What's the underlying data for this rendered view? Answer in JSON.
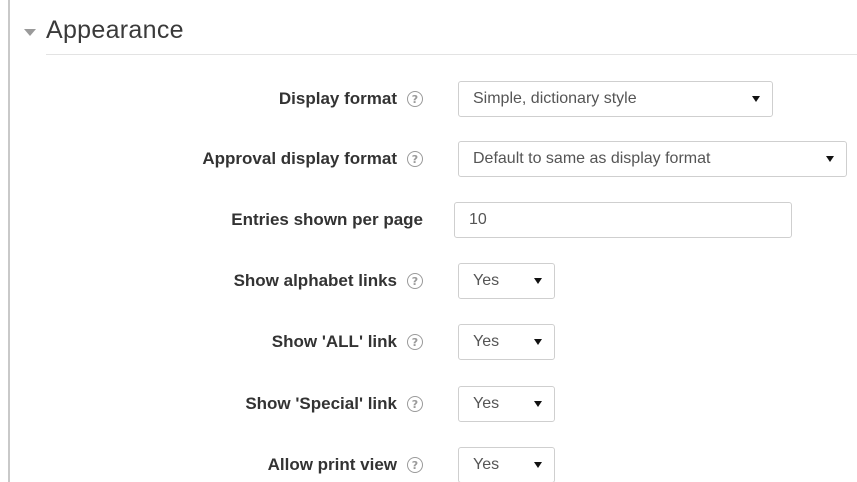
{
  "section": {
    "title": "Appearance"
  },
  "fields": {
    "display_format": {
      "label": "Display format",
      "value": "Simple, dictionary style"
    },
    "approval_display_format": {
      "label": "Approval display format",
      "value": "Default to same as display format"
    },
    "entries_per_page": {
      "label": "Entries shown per page",
      "value": "10"
    },
    "show_alphabet_links": {
      "label": "Show alphabet links",
      "value": "Yes"
    },
    "show_all_link": {
      "label": "Show 'ALL' link",
      "value": "Yes"
    },
    "show_special_link": {
      "label": "Show 'Special' link",
      "value": "Yes"
    },
    "allow_print_view": {
      "label": "Allow print view",
      "value": "Yes"
    }
  },
  "icons": {
    "help": "help-icon",
    "collapse": "collapse-arrow-icon",
    "dropdown": "caret-down-icon"
  },
  "colors": {
    "border": "#cfcfcf",
    "label": "#333333",
    "icon": "#9a9a9a"
  }
}
